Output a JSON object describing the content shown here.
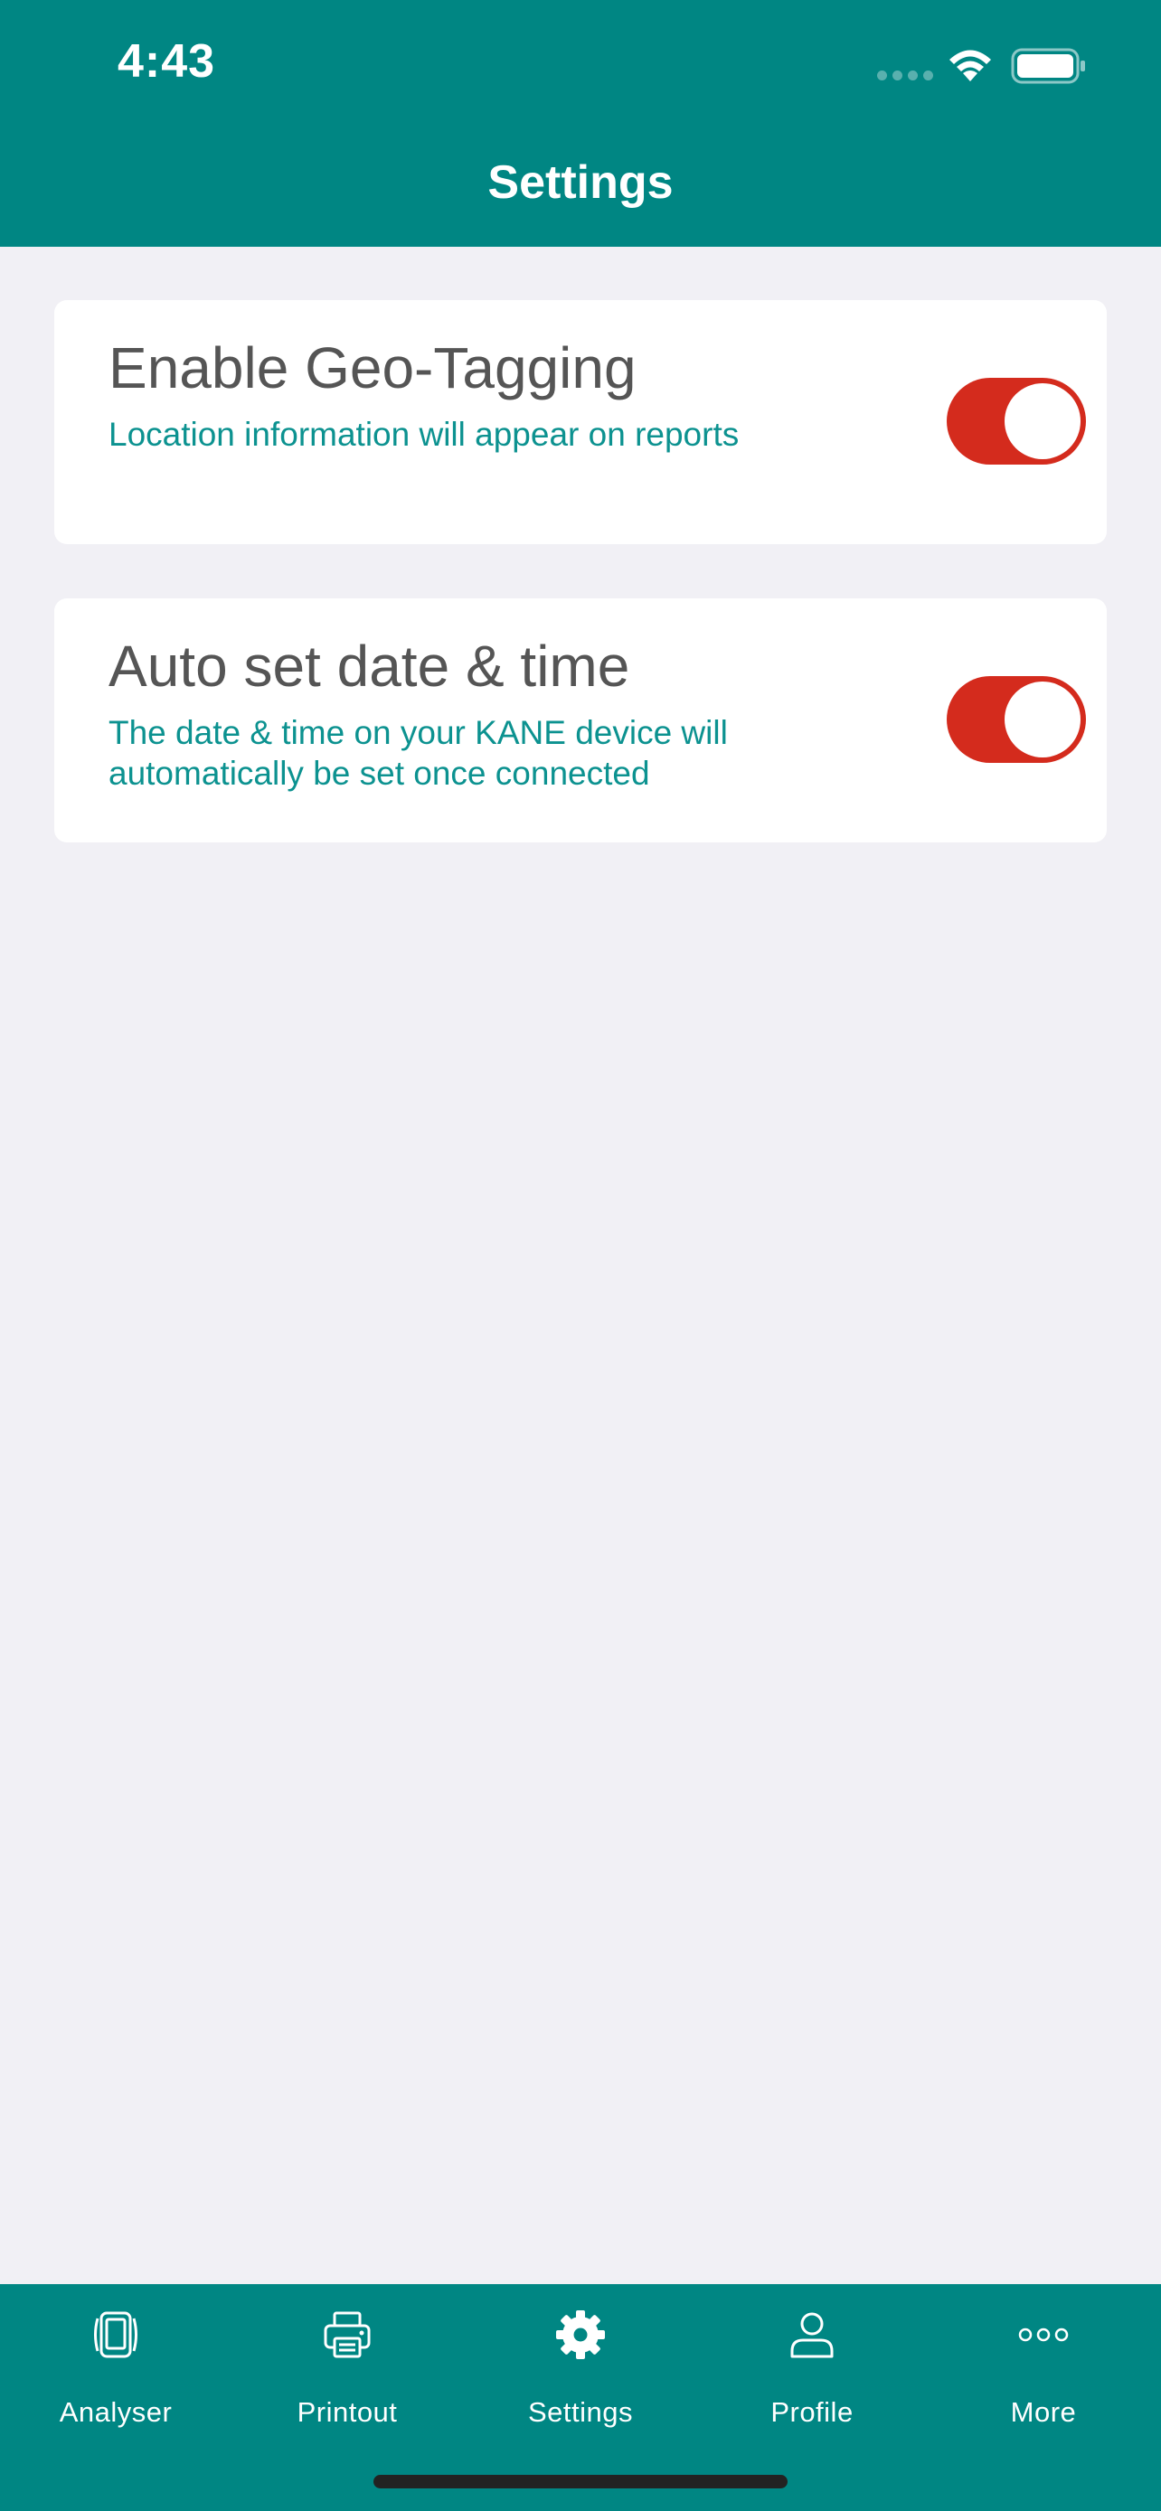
{
  "status_bar": {
    "time": "4:43"
  },
  "header": {
    "title": "Settings"
  },
  "settings": [
    {
      "title": "Enable Geo-Tagging",
      "description": "Location information will appear on reports",
      "enabled": true
    },
    {
      "title": "Auto set date & time",
      "description": "The date & time on your KANE device will automatically be set once connected",
      "enabled": true
    }
  ],
  "tabs": [
    {
      "label": "Analyser",
      "icon": "analyser-icon"
    },
    {
      "label": "Printout",
      "icon": "printer-icon"
    },
    {
      "label": "Settings",
      "icon": "gear-icon"
    },
    {
      "label": "Profile",
      "icon": "person-icon"
    },
    {
      "label": "More",
      "icon": "more-icon"
    }
  ],
  "colors": {
    "header": "#008683",
    "background": "#f1f0f5",
    "toggle_on": "#d42b1d",
    "subtitle": "#0c9290",
    "title": "#555555"
  }
}
